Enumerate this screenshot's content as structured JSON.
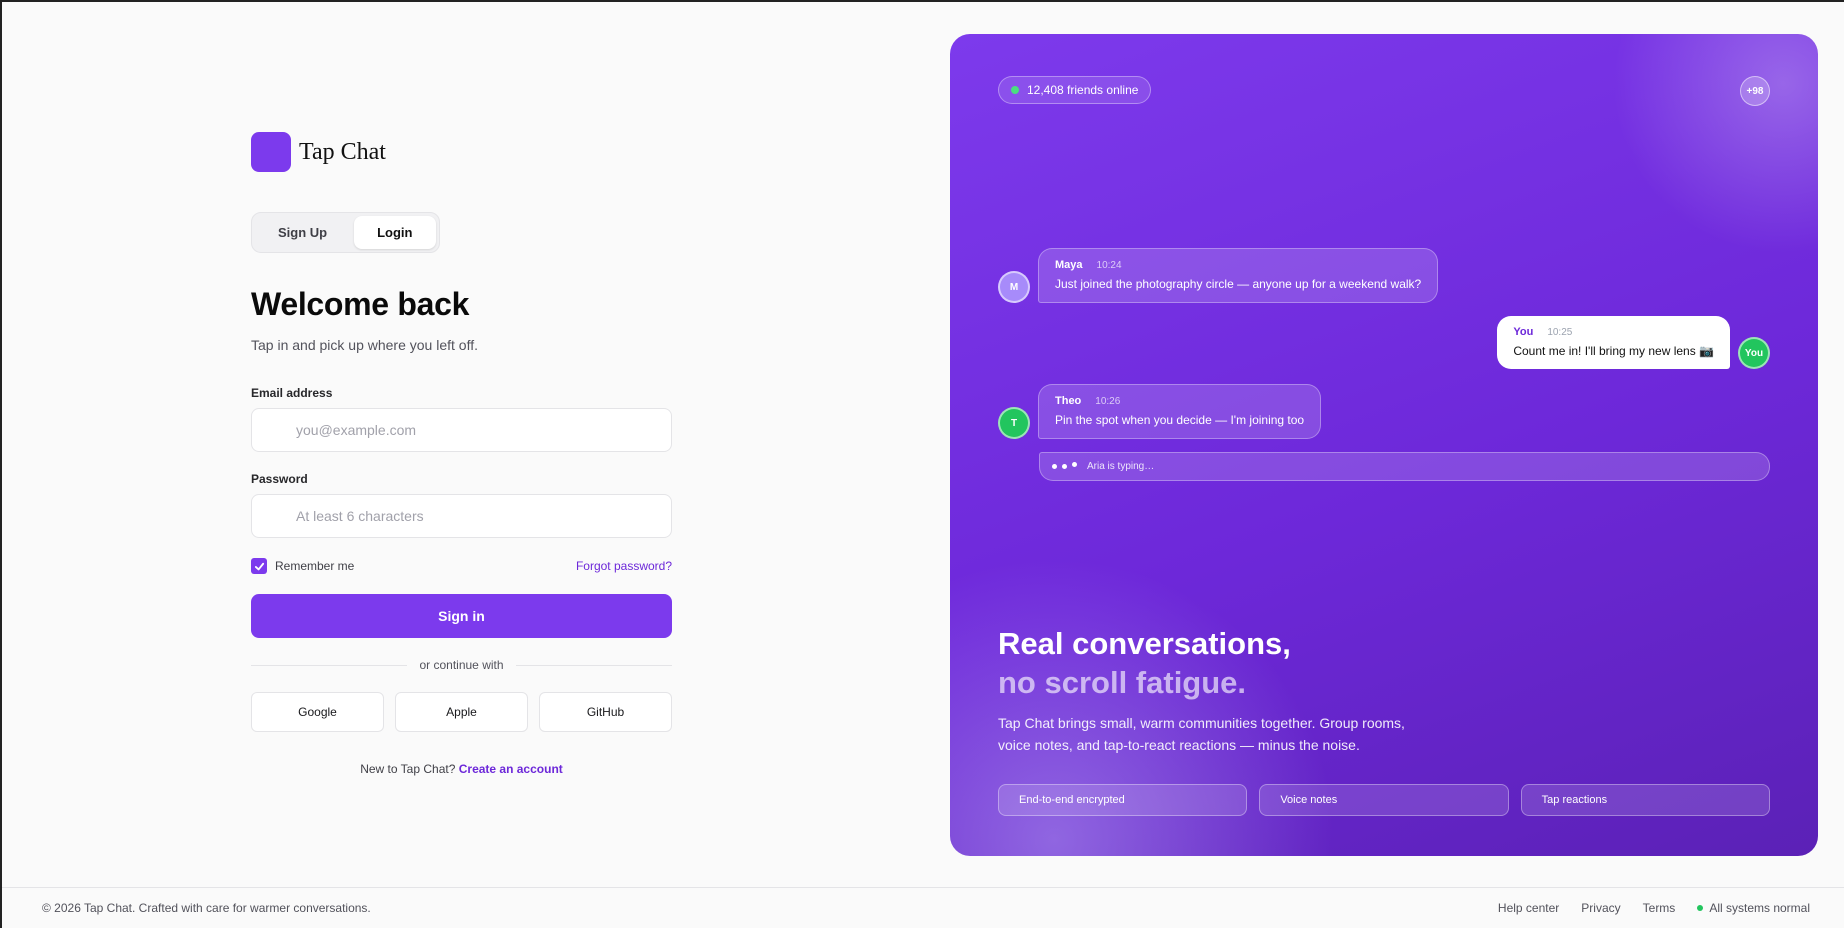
{
  "brand": {
    "name": "Tap Chat"
  },
  "auth": {
    "tabs": [
      {
        "label": "Sign Up"
      },
      {
        "label": "Login",
        "active": true
      }
    ],
    "title": "Welcome back",
    "subtitle": "Tap in and pick up where you left off.",
    "email": {
      "label": "Email address",
      "placeholder": "you@example.com",
      "value": ""
    },
    "password": {
      "label": "Password",
      "placeholder": "At least 6 characters",
      "value": ""
    },
    "remember": {
      "label": "Remember me",
      "checked": true
    },
    "forgot_label": "Forgot password?",
    "submit_label": "Sign in",
    "divider_label": "or continue with",
    "socials": [
      {
        "label": "Google"
      },
      {
        "label": "Apple"
      },
      {
        "label": "GitHub"
      }
    ],
    "new_to": "New to Tap Chat?",
    "create_account": "Create an account"
  },
  "hero": {
    "online_label": "12,408 friends online",
    "more_badge": "+98",
    "messages": [
      {
        "initial": "M",
        "name": "Maya",
        "time": "10:24",
        "text": "Just joined the photography circle — anyone up for a weekend walk?"
      },
      {
        "initial": "You",
        "name": "You",
        "time": "10:25",
        "text": "Count me in! I'll bring my new lens 📷"
      },
      {
        "initial": "T",
        "name": "Theo",
        "time": "10:26",
        "text": "Pin the spot when you decide — I'm joining too"
      }
    ],
    "typing_label": "Aria is typing…",
    "headline_line1": "Real conversations,",
    "headline_line2": "no scroll fatigue.",
    "description": "Tap Chat brings small, warm communities together. Group rooms, voice notes, and tap-to-react reactions — minus the noise.",
    "features": [
      {
        "label": "End-to-end encrypted"
      },
      {
        "label": "Voice notes"
      },
      {
        "label": "Tap reactions"
      }
    ]
  },
  "footer": {
    "copyright": "© 2026 Tap Chat. Crafted with care for warmer conversations.",
    "links": [
      {
        "label": "Help center"
      },
      {
        "label": "Privacy"
      },
      {
        "label": "Terms"
      }
    ],
    "status_label": "All systems normal"
  },
  "colors": {
    "accent": "#7c3aed",
    "accent_dark": "#6d28d9",
    "online": "#4ade80",
    "status_ok": "#22c55e"
  }
}
